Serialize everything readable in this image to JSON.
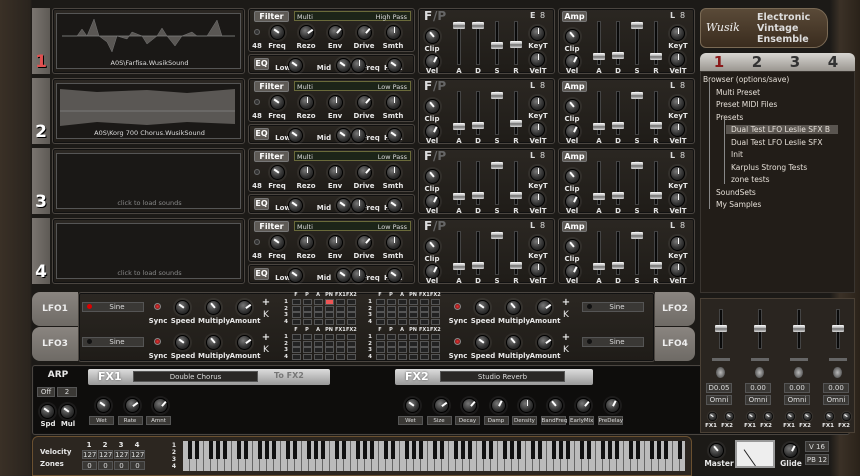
{
  "voices": [
    {
      "num": "1",
      "sample": "A0S\\Farfisa.WusikSound",
      "filter_type": "Multi",
      "filter_mode": "High Pass",
      "env_mode": "E",
      "filter_knobs": [
        0.3,
        0.7,
        0.65,
        0.65,
        0.5
      ],
      "fp_sliders": [
        1,
        1,
        0.45,
        0.5
      ],
      "amp_sliders": [
        0.15,
        0.2,
        1,
        0.15
      ],
      "color": "#e05050"
    },
    {
      "num": "2",
      "sample": "A0S\\Korg 700 Chorus.WusikSound",
      "filter_type": "Multi",
      "filter_mode": "Low Pass",
      "env_mode": "L",
      "filter_knobs": [
        0.3,
        0.5,
        0.5,
        0.65,
        0.5
      ],
      "fp_sliders": [
        0.15,
        0.2,
        1,
        0.25
      ],
      "amp_sliders": [
        0.15,
        0.2,
        1,
        0.2
      ],
      "color": "#ffffff"
    },
    {
      "num": "3",
      "sample": "click to load sounds",
      "filter_type": "Multi",
      "filter_mode": "Low Pass",
      "env_mode": "L",
      "filter_knobs": [
        0.3,
        0.5,
        0.5,
        0.65,
        0.5
      ],
      "fp_sliders": [
        0.15,
        0.2,
        1,
        0.2
      ],
      "amp_sliders": [
        0.15,
        0.2,
        1,
        0.2
      ],
      "color": "#ffffff"
    },
    {
      "num": "4",
      "sample": "click to load sounds",
      "filter_type": "Multi",
      "filter_mode": "Low Pass",
      "env_mode": "L",
      "filter_knobs": [
        0.3,
        0.5,
        0.5,
        0.65,
        0.5
      ],
      "fp_sliders": [
        0.15,
        0.2,
        1,
        0.2
      ],
      "amp_sliders": [
        0.15,
        0.2,
        1,
        0.2
      ],
      "color": "#ffffff"
    }
  ],
  "filter": {
    "label": "Filter",
    "slope": "48",
    "knobs": [
      "Freq",
      "Rezo",
      "Env",
      "Drive",
      "Smth"
    ],
    "eq_label": "EQ",
    "eq_knobs": [
      "Low",
      "Mid",
      "Freq",
      "High"
    ]
  },
  "env": {
    "fp_label_f": "F",
    "fp_label_p": "/P",
    "amp_label": "Amp",
    "clip": "Clip",
    "vel": "Vel",
    "adsr": [
      "A",
      "D",
      "S",
      "R"
    ],
    "keyt": "KeyT",
    "velt": "VelT",
    "lock_icon": "lock-icon"
  },
  "logo": {
    "brand": "Wusik",
    "line1": "Electronic",
    "line2": "Vintage",
    "line3": "Ensemble"
  },
  "part_tabs": [
    "1",
    "2",
    "3",
    "4"
  ],
  "active_part": 0,
  "browser": [
    {
      "label": "Browser (options/save)",
      "level": 0
    },
    {
      "label": "Multi Preset",
      "level": 1
    },
    {
      "label": "Preset MIDI Files",
      "level": 1
    },
    {
      "label": "Presets",
      "level": 1
    },
    {
      "label": "Dual Test LFO Leslie SFX B",
      "level": 2,
      "selected": true
    },
    {
      "label": "Dual Test LFO Leslie SFX",
      "level": 2
    },
    {
      "label": "Init",
      "level": 2
    },
    {
      "label": "Karplus Strong Tests",
      "level": 2
    },
    {
      "label": "zone tests",
      "level": 2
    },
    {
      "label": "SoundSets",
      "level": 1
    },
    {
      "label": "My Samples",
      "level": 1
    }
  ],
  "lfo": {
    "units": [
      {
        "name": "LFO1",
        "wave": "Sine",
        "led_on": true
      },
      {
        "name": "LFO3",
        "wave": "Sine",
        "led_on": false
      },
      {
        "name": "LFO2",
        "wave": "Sine",
        "led_on": false
      },
      {
        "name": "LFO4",
        "wave": "Sine",
        "led_on": false
      }
    ],
    "sync": "Sync",
    "knobs": [
      "Speed",
      "Multiply",
      "Amount"
    ],
    "plus": "+",
    "k": "K",
    "matrix_cols": [
      "F",
      "P",
      "A",
      "PN",
      "FX1",
      "FX2"
    ],
    "matrix_rows": [
      "1",
      "2",
      "3",
      "4"
    ],
    "active_cells": [
      {
        "matrix": 0,
        "row": 0,
        "col": 3
      }
    ]
  },
  "arp": {
    "title": "ARP",
    "mode": "Off",
    "value": "2",
    "knobs": [
      "Spd",
      "Mul"
    ]
  },
  "fx1": {
    "title": "FX1",
    "effect": "Double Chorus",
    "route": "To FX2",
    "knobs": [
      "Wet",
      "Rate",
      "Amnt"
    ]
  },
  "fx2": {
    "title": "FX2",
    "effect": "Studio Reverb",
    "knobs": [
      "Wet",
      "Size",
      "Decay",
      "Damp",
      "Density",
      "BandFreq",
      "EarlyMix",
      "PreDelay"
    ]
  },
  "mixer": {
    "channels": [
      {
        "value": "D0.05",
        "midi": "Omni",
        "level": 0.55
      },
      {
        "value": "0.00",
        "midi": "Omni",
        "level": 0.55
      },
      {
        "value": "0.00",
        "midi": "Omni",
        "level": 0.55
      },
      {
        "value": "0.00",
        "midi": "Omni",
        "level": 0.55
      }
    ],
    "fx1": "FX1",
    "fx2": "FX2"
  },
  "velocity": {
    "label1": "Velocity",
    "label2": "Zones",
    "cols": [
      "1",
      "2",
      "3",
      "4"
    ],
    "high": [
      "127",
      "127",
      "127",
      "127"
    ],
    "low": [
      "0",
      "0",
      "0",
      "0"
    ]
  },
  "keyboard": {
    "rows": [
      "1",
      "2",
      "3",
      "4"
    ]
  },
  "master": {
    "label": "Master",
    "glide": "Glide",
    "voices": "V 16",
    "pitchbend": "PB 12"
  }
}
